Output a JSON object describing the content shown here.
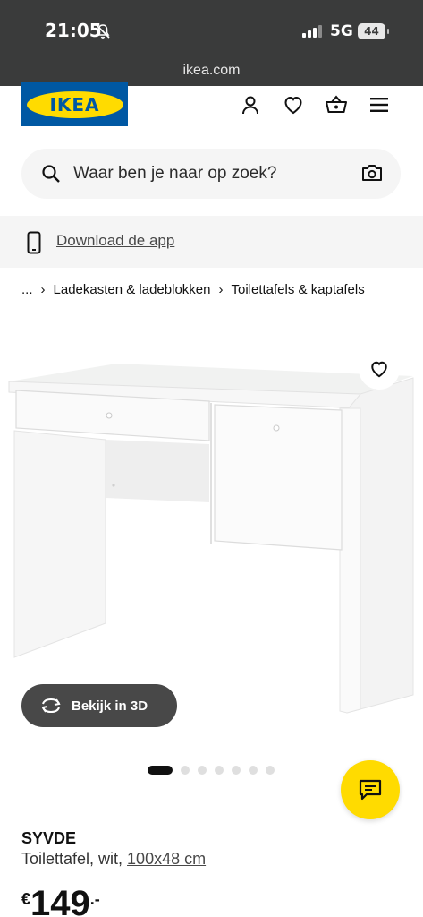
{
  "status_bar": {
    "time": "21:05",
    "network": "5G",
    "battery": "44"
  },
  "browser": {
    "url": "ikea.com"
  },
  "header": {
    "logo_text": "IKEA",
    "icons": [
      "user-icon",
      "heart-icon",
      "basket-icon",
      "menu-icon"
    ]
  },
  "search": {
    "placeholder": "Waar ben je naar op zoek?"
  },
  "app_banner": {
    "label": "Download de app"
  },
  "breadcrumb": {
    "ellipsis": "...",
    "items": [
      "Ladekasten & ladeblokken",
      "Toilettafels & kaptafels"
    ]
  },
  "gallery": {
    "view_3d_label": "Bekijk in 3D",
    "image_count": 7,
    "active_index": 0
  },
  "product": {
    "name": "SYVDE",
    "description": "Toilettafel, wit, ",
    "size": "100x48 cm",
    "price_currency": "€",
    "price_integer": "149",
    "price_decimal": ".-"
  },
  "colors": {
    "ikea_blue": "#0058a3",
    "ikea_yellow": "#ffdb00",
    "chrome_dark": "#3a3b3b"
  }
}
